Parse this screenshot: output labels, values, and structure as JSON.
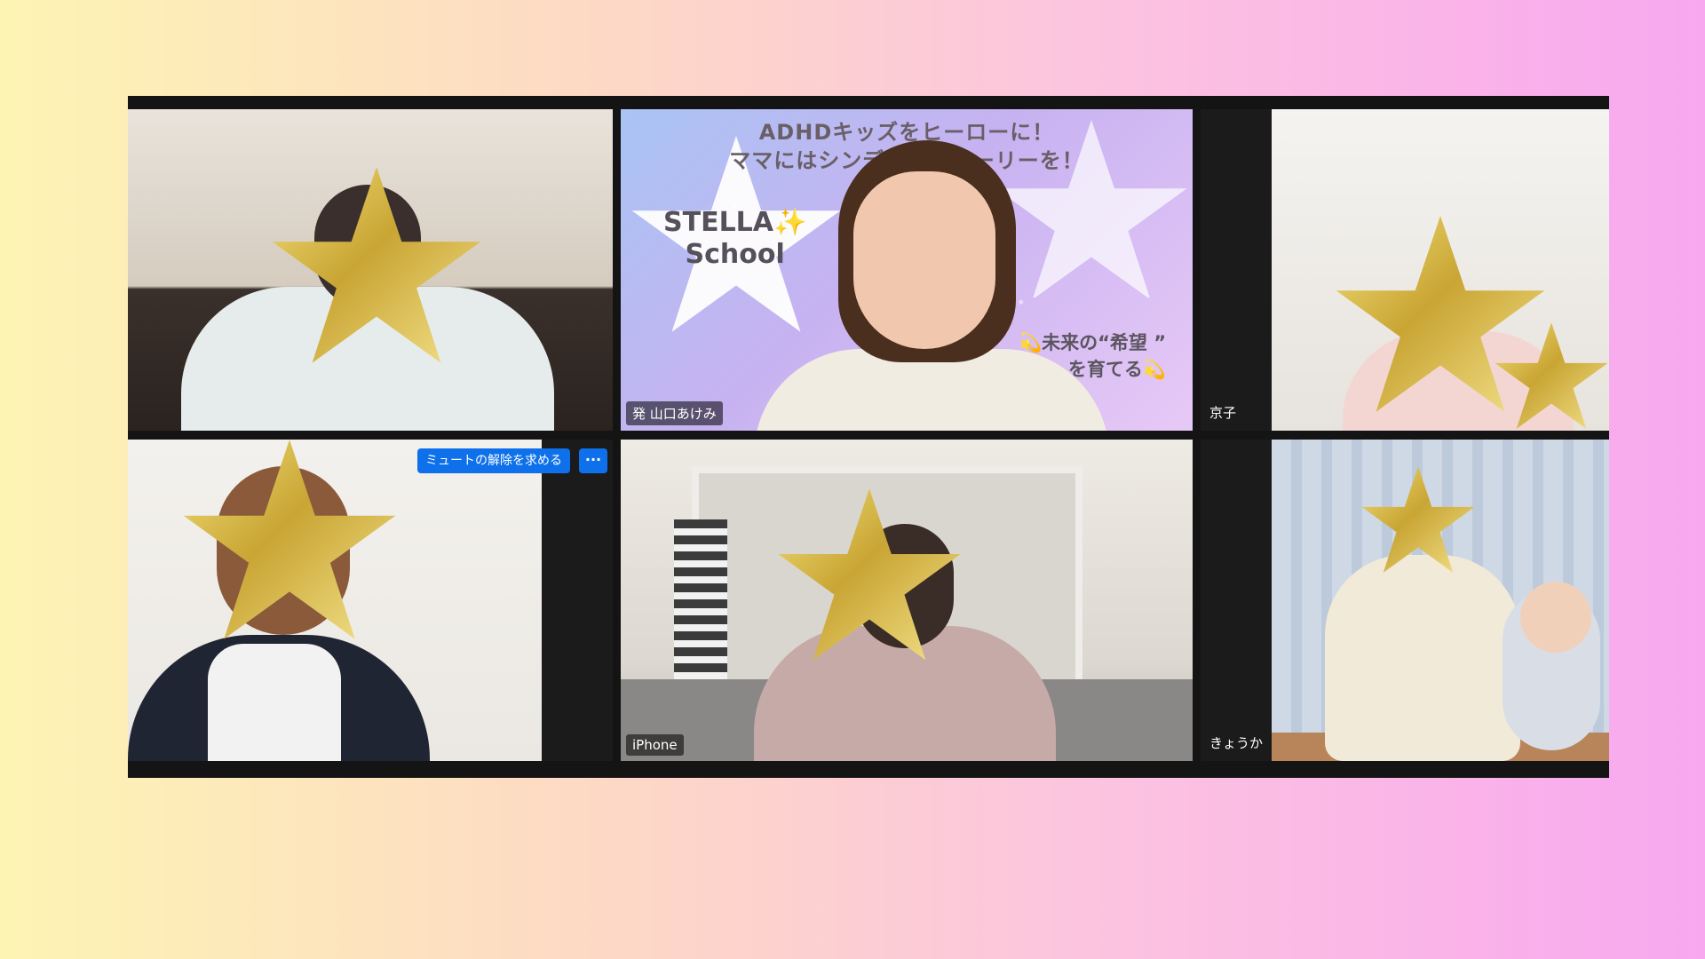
{
  "meeting": {
    "participants": [
      {
        "id": "p1",
        "name": "",
        "camera": "on"
      },
      {
        "id": "p2",
        "name": "発 山口あけみ",
        "camera": "on",
        "speaking": true
      },
      {
        "id": "p3",
        "name": "京子",
        "camera": "on"
      },
      {
        "id": "p4",
        "name": "",
        "camera": "on"
      },
      {
        "id": "p5",
        "name": "iPhone",
        "camera": "on"
      },
      {
        "id": "p6",
        "name": "きょうか",
        "camera": "on"
      }
    ],
    "host_controls": {
      "ask_unmute_label": "ミュートの解除を求める",
      "more_label": "···"
    },
    "presenter_background": {
      "title_line1": "ADHDキッズをヒーローに！",
      "title_line2": "ママにはシンデレラストーリーを！",
      "brand_line1": "STELLA",
      "brand_spark": "✨",
      "brand_line2": "School",
      "tagline_line1": "💫未来の“希望 ”",
      "tagline_line2": "を育てる💫"
    }
  },
  "colors": {
    "active_speaker_border": "#35d135",
    "button_blue": "#0e71eb",
    "star_gold": "#d4b43a"
  },
  "icons": [
    "star-icon",
    "more-icon"
  ]
}
